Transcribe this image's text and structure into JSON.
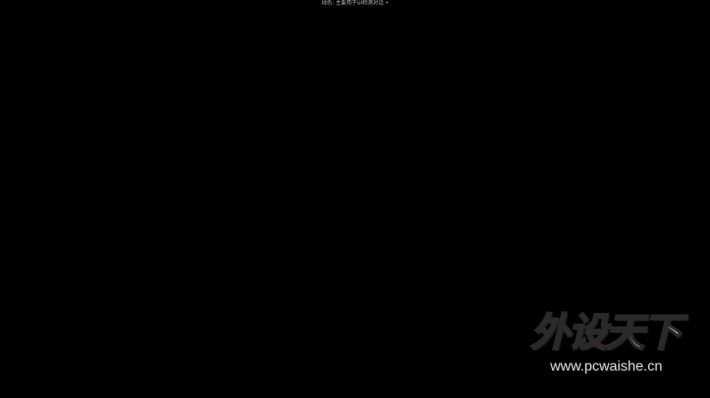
{
  "caption": {
    "text": "线色: 主要用于UI检测对话 •"
  },
  "watermark": {
    "title_red": "外设",
    "title_white": "天下",
    "url": "www.pcwaishe.cn"
  },
  "colors": {
    "background": "#000000",
    "caption_text": "#b9b9b9",
    "logo_red": "#c6161c",
    "logo_white": "#f2f2f2"
  }
}
